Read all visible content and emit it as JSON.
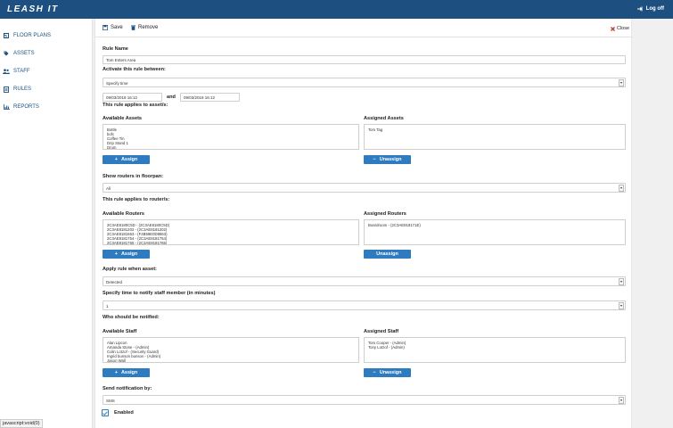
{
  "app": {
    "title": "LEASH IT",
    "logoff_label": "Log off"
  },
  "sidebar": {
    "items": [
      {
        "label": "FLOOR PLANS",
        "icon": "floor-plan-icon"
      },
      {
        "label": "ASSETS",
        "icon": "tag-icon"
      },
      {
        "label": "STAFF",
        "icon": "users-icon"
      },
      {
        "label": "RULES",
        "icon": "document-icon"
      },
      {
        "label": "REPORTS",
        "icon": "bar-chart-icon"
      }
    ]
  },
  "status_bar": {
    "text": "javascript:void(0)"
  },
  "toolbar": {
    "save_label": "Save",
    "remove_label": "Remove",
    "close_label": "Close"
  },
  "form": {
    "rule_name": {
      "label": "Rule Name",
      "value": "Tom Enters Area"
    },
    "activate": {
      "label": "Activate this rule between:",
      "selected": "Specify time",
      "start": "09/03/2018 16:12",
      "and_label": "and",
      "end": "09/03/2018 16:12"
    },
    "assets": {
      "section_label": "This rule applies to asset/s:",
      "available_label": "Available Assets",
      "available": [
        "Bottle",
        "bofc",
        "Coffee Tin",
        "Drip Stand 1",
        "Drum"
      ],
      "assigned_label": "Assigned Assets",
      "assigned": [
        "Tom Tag"
      ],
      "assign_label": "Assign",
      "unassign_label": "Unassign"
    },
    "routers": {
      "show_label": "Show routers in floorpan:",
      "show_selected": "All",
      "section_label": "This rule applies to router/s:",
      "available_label": "Available Routers",
      "available": [
        "2C3AE8180C5D - (2C3AE8180C5D)",
        "2C3AE8181202 - (2C3AE8181202)",
        "2C3AE8181663 - (F4B59E0D8863)",
        "2C3AE8181754 - (2C3AE8181754)",
        "2C3AE8181765 - (2C3AE8181765)"
      ],
      "assigned_label": "Assigned Routers",
      "assigned": [
        "Boardroom - (2C3AE818171E)"
      ],
      "assign_label": "Assign",
      "unassign_label": "Unassign"
    },
    "apply_when": {
      "label": "Apply rule when asset:",
      "selected": "Detected"
    },
    "notify_time": {
      "label": "Specify time to notify staff member (in minutes)",
      "selected": "1"
    },
    "staff": {
      "section_label": "Who should be notified:",
      "available_label": "Available Staff",
      "available": [
        "Alan Lipcon",
        "Amanda Stone - (Admin)",
        "Colin Lotzof - (Security Guard)",
        "Ingrid bunson bunson - (Admin)",
        "Jason Wall"
      ],
      "assigned_label": "Assigned Staff",
      "assigned": [
        "Tom Cooper - (Admin)",
        "Tony Lotzof - (Admin)"
      ],
      "assign_label": "Assign",
      "unassign_label": "Unassign"
    },
    "send_by": {
      "label": "Send notification by:",
      "selected": "SMS"
    },
    "enabled": {
      "label": "Enabled",
      "checked": true
    }
  },
  "colors": {
    "topbar": "#1d4f80",
    "button": "#2f7bbf",
    "close_x": "#c0392b"
  }
}
